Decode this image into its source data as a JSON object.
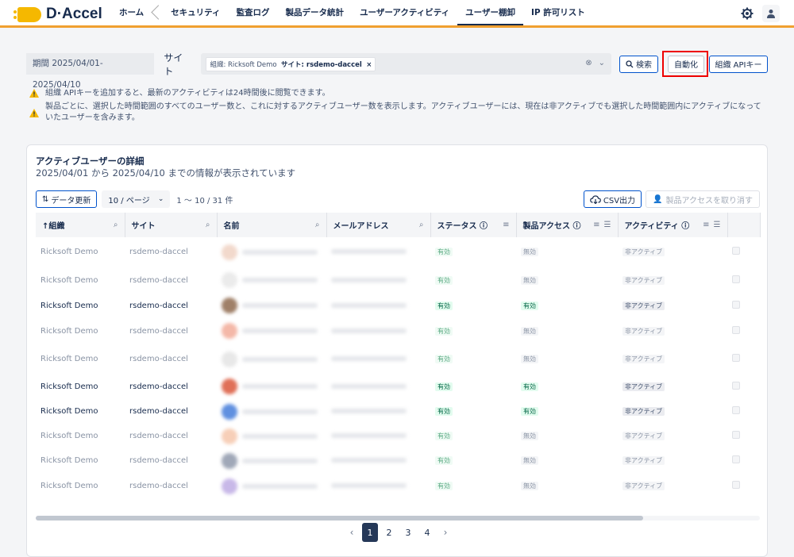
{
  "app": {
    "name": "D·Accel"
  },
  "nav": {
    "items": [
      "ホーム",
      "セキュリティ",
      "監査ログ",
      "製品データ統計",
      "ユーザーアクティビティ",
      "ユーザー棚卸",
      "IP 許可リスト"
    ]
  },
  "filters": {
    "period": "期間 2025/04/01-2025/04/10",
    "site_label": "サイト",
    "chip_prefix": "組織: Ricksoft Demo",
    "chip_site": "サイト: rsdemo-daccel",
    "chip_close": "×",
    "search_label": "検索",
    "auto_label": "自動化",
    "api_key_label": "組織 APIキー"
  },
  "notices": [
    "組織 APIキーを追加すると、最新のアクティビティは24時間後に閲覧できます。",
    "製品ごとに、選択した時間範囲のすべてのユーザー数と、これに対するアクティブユーザー数を表示します。アクティブユーザーには、現在は非アクティブでも選択した時間範囲内にアクティブになっていたユーザーを含みます。"
  ],
  "card": {
    "title": "アクティブユーザーの詳細",
    "subtitle": "2025/04/01 から 2025/04/10 までの情報が表示されています",
    "refresh_label": "データ更新",
    "page_size": "10 / ページ",
    "range": "1 〜 10 / 31 件",
    "csv_label": "CSV出力",
    "revoke_label": "製品アクセスを取り消す"
  },
  "table": {
    "headers": [
      "組織",
      "サイト",
      "名前",
      "メールアドレス",
      "ステータス",
      "製品アクセス",
      "アクティビティ"
    ],
    "sort_arrow": "↑",
    "rows": [
      {
        "org": "Ricksoft Demo",
        "site": "rsdemo-daccel",
        "status": "有効",
        "access": "無効",
        "activity": "非アクティブ",
        "active": false
      },
      {
        "org": "Ricksoft Demo",
        "site": "rsdemo-daccel",
        "status": "有効",
        "access": "無効",
        "activity": "非アクティブ",
        "active": false
      },
      {
        "org": "Ricksoft Demo",
        "site": "rsdemo-daccel",
        "status": "有効",
        "access": "有効",
        "activity": "非アクティブ",
        "active": true
      },
      {
        "org": "Ricksoft Demo",
        "site": "rsdemo-daccel",
        "status": "有効",
        "access": "無効",
        "activity": "非アクティブ",
        "active": false
      },
      {
        "org": "Ricksoft Demo",
        "site": "rsdemo-daccel",
        "status": "有効",
        "access": "無効",
        "activity": "非アクティブ",
        "active": false
      },
      {
        "org": "Ricksoft Demo",
        "site": "rsdemo-daccel",
        "status": "有効",
        "access": "有効",
        "activity": "非アクティブ",
        "active": true
      },
      {
        "org": "Ricksoft Demo",
        "site": "rsdemo-daccel",
        "status": "有効",
        "access": "有効",
        "activity": "非アクティブ",
        "active": true
      },
      {
        "org": "Ricksoft Demo",
        "site": "rsdemo-daccel",
        "status": "有効",
        "access": "無効",
        "activity": "非アクティブ",
        "active": false
      },
      {
        "org": "Ricksoft Demo",
        "site": "rsdemo-daccel",
        "status": "有効",
        "access": "無効",
        "activity": "非アクティブ",
        "active": false
      },
      {
        "org": "Ricksoft Demo",
        "site": "rsdemo-daccel",
        "status": "有効",
        "access": "無効",
        "activity": "非アクティブ",
        "active": false
      }
    ]
  },
  "pagination": {
    "pages": [
      "1",
      "2",
      "3",
      "4"
    ],
    "current": "1",
    "prev": "‹",
    "next": "›"
  },
  "colors": {
    "accent": "#f5b800",
    "primary": "#0052cc",
    "highlight": "#e00000"
  }
}
